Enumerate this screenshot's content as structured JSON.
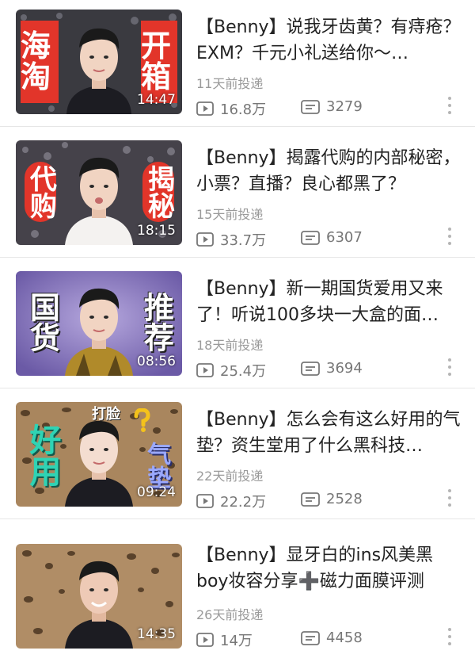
{
  "videos": [
    {
      "title": "【Benny】说我牙齿黄？有痔疮？EXM？千元小礼送给你～…",
      "upload_time": "11天前投递",
      "plays": "16.8万",
      "comments": "3279",
      "duration": "14:47",
      "thumb_words": [
        "海淘",
        "开箱"
      ],
      "theme": "sequin"
    },
    {
      "title": "【Benny】揭露代购的内部秘密，小票？直播？良心都黑了？",
      "upload_time": "15天前投递",
      "plays": "33.7万",
      "comments": "6307",
      "duration": "18:15",
      "thumb_words": [
        "代购",
        "揭秘"
      ],
      "theme": "sequin"
    },
    {
      "title": "【Benny】新一期国货爱用又来了！听说100多块一大盒的面…",
      "upload_time": "18天前投递",
      "plays": "25.4万",
      "comments": "3694",
      "duration": "08:56",
      "thumb_words": [
        "国货",
        "推荐"
      ],
      "theme": "purple"
    },
    {
      "title": "【Benny】怎么会有这么好用的气垫？资生堂用了什么黑科技…",
      "upload_time": "22天前投递",
      "plays": "22.2万",
      "comments": "2528",
      "duration": "09:24",
      "thumb_words": [
        "好用",
        "气垫",
        "打脸"
      ],
      "theme": "leopard"
    },
    {
      "title": "【Benny】显牙白的ins风美黑boy妆容分享➕磁力面膜评测",
      "upload_time": "26天前投递",
      "plays": "14万",
      "comments": "4458",
      "duration": "14:35",
      "thumb_words": [],
      "theme": "leopard"
    }
  ],
  "colors": {
    "title_text": "#222222",
    "meta_text": "#9a9a9a",
    "stat_text": "#777777",
    "divider": "#e6e6e6"
  },
  "icons": {
    "play": "play-count-icon",
    "comment": "comment-count-icon",
    "more": "more-vertical-icon"
  }
}
